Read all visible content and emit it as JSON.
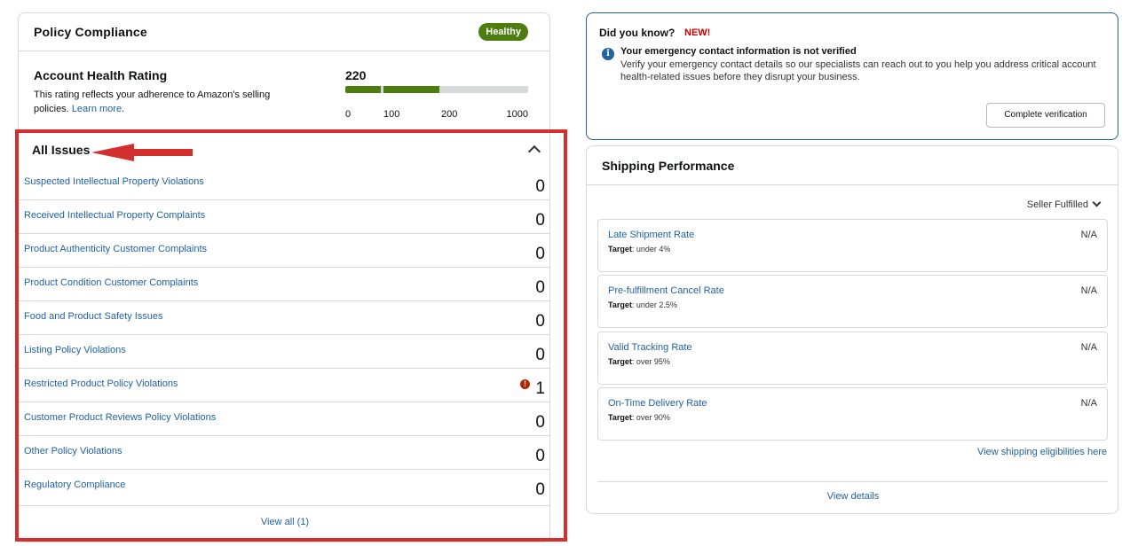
{
  "policy_compliance": {
    "title": "Policy Compliance",
    "status_badge": "Healthy",
    "account_health": {
      "title": "Account Health Rating",
      "description": "This rating reflects your adherence to Amazon's selling policies.",
      "learn_more": "Learn more",
      "score": "220",
      "scale_ticks": [
        "0",
        "100",
        "200",
        "1000"
      ]
    },
    "issues": {
      "title": "All Issues",
      "items": [
        {
          "label": "Suspected Intellectual Property Violations",
          "count": "0"
        },
        {
          "label": "Received Intellectual Property Complaints",
          "count": "0"
        },
        {
          "label": "Product Authenticity Customer Complaints",
          "count": "0"
        },
        {
          "label": "Product Condition Customer Complaints",
          "count": "0"
        },
        {
          "label": "Food and Product Safety Issues",
          "count": "0"
        },
        {
          "label": "Listing Policy Violations",
          "count": "0"
        },
        {
          "label": "Restricted Product Policy Violations",
          "count": "1",
          "alert": "!"
        },
        {
          "label": "Customer Product Reviews Policy Violations",
          "count": "0"
        },
        {
          "label": "Other Policy Violations",
          "count": "0"
        },
        {
          "label": "Regulatory Compliance",
          "count": "0"
        }
      ],
      "view_all": "View all (1)"
    }
  },
  "did_you_know": {
    "title": "Did you know?",
    "new_tag": "NEW!",
    "info_icon": "i",
    "heading": "Your emergency contact information is not verified",
    "body": "Verify your emergency contact details so our specialists can reach out to you help you address critical account health-related issues before they disrupt your business.",
    "button": "Complete verification"
  },
  "shipping_performance": {
    "title": "Shipping Performance",
    "filter": "Seller Fulfilled",
    "target_label": "Target",
    "metrics": [
      {
        "name": "Late Shipment Rate",
        "target": ": under 4%",
        "value": "N/A"
      },
      {
        "name": "Pre-fulfillment Cancel Rate",
        "target": ": under 2.5%",
        "value": "N/A"
      },
      {
        "name": "Valid Tracking Rate",
        "target": ": over 95%",
        "value": "N/A"
      },
      {
        "name": "On-Time Delivery Rate",
        "target": ": over 90%",
        "value": "N/A"
      }
    ],
    "eligibility_link": "View shipping eligibilities here",
    "details_link": "View details"
  },
  "annotation": {
    "highlight_color": "#d32f2f"
  }
}
